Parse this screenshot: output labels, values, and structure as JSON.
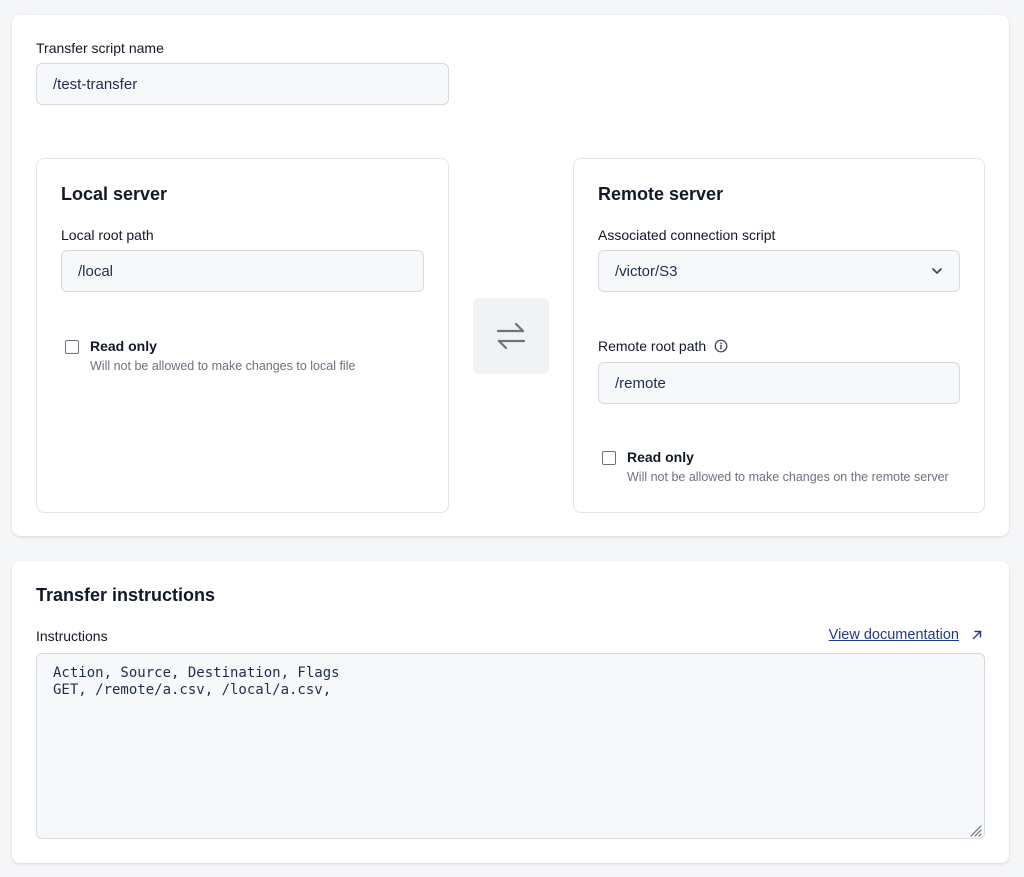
{
  "script_name": {
    "label": "Transfer script name",
    "value": "/test-transfer"
  },
  "local_server": {
    "title": "Local server",
    "root_path_label": "Local root path",
    "root_path_value": "/local",
    "read_only": {
      "label": "Read only",
      "help": "Will not be allowed to make changes to local file",
      "checked": false
    }
  },
  "swap": {
    "icon": "swap-arrows-icon"
  },
  "remote_server": {
    "title": "Remote server",
    "connection_label": "Associated connection script",
    "connection_value": "/victor/S3",
    "root_path_label": "Remote root path",
    "root_path_value": "/remote",
    "info_icon": "info-icon",
    "read_only": {
      "label": "Read only",
      "help": "Will not be allowed to make changes on the remote server",
      "checked": false
    }
  },
  "instructions": {
    "section_title": "Transfer instructions",
    "label": "Instructions",
    "doc_link": "View documentation",
    "doc_icon": "external-link-icon",
    "content": "Action, Source, Destination, Flags\nGET, /remote/a.csv, /local/a.csv,"
  },
  "colors": {
    "text": "#111827",
    "link": "#1e3a8a",
    "input_bg": "#f7f8fa",
    "border": "#d5d9e0",
    "muted": "#6b7280"
  }
}
